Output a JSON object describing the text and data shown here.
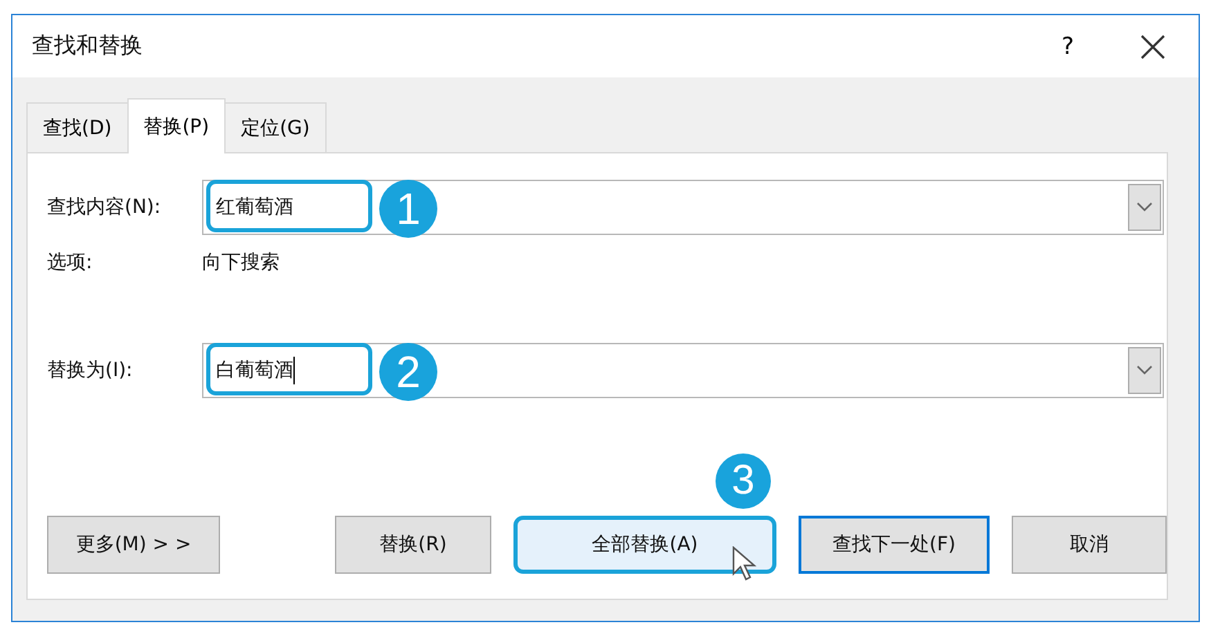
{
  "window": {
    "title": "查找和替换",
    "help": "?"
  },
  "tabs": [
    {
      "label": "查找(D)",
      "selected": false
    },
    {
      "label": "替换(P)",
      "selected": true
    },
    {
      "label": "定位(G)",
      "selected": false
    }
  ],
  "find": {
    "label": "查找内容(N):",
    "value": "红葡萄酒",
    "callout": "1"
  },
  "options": {
    "label": "选项:",
    "value": "向下搜索"
  },
  "replace": {
    "label": "替换为(I):",
    "value": "白葡萄酒",
    "callout": "2",
    "text_cursor": true
  },
  "buttons": [
    {
      "label": "更多(M) > >",
      "focused": false,
      "hovered": false
    },
    {
      "label": "替换(R)",
      "focused": false,
      "hovered": false
    },
    {
      "label": "全部替换(A)",
      "focused": false,
      "hovered": true,
      "callout": "3"
    },
    {
      "label": "查找下一处(F)",
      "focused": true,
      "hovered": false
    },
    {
      "label": "取消",
      "focused": false,
      "hovered": false
    }
  ]
}
